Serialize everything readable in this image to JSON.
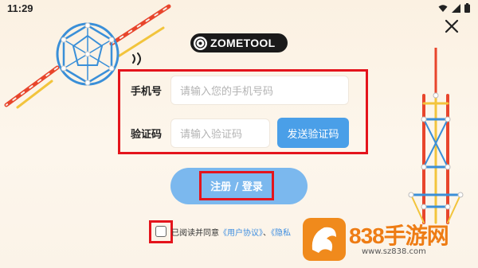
{
  "status_bar": {
    "time": "11:29"
  },
  "logo": {
    "text": "ZOMETOOL"
  },
  "form": {
    "phone_label": "手机号",
    "phone_placeholder": "请输入您的手机号码",
    "code_label": "验证码",
    "code_placeholder": "请输入验证码",
    "send_code_label": "发送验证码"
  },
  "login_button": {
    "label": "注册 / 登录"
  },
  "agreement": {
    "prefix": "已阅读并同意",
    "user_agreement": "《用户协议》",
    "separator": "、",
    "privacy": "《隐私"
  },
  "watermark": {
    "name": "838手游网",
    "url": "www.sz838.com"
  },
  "colors": {
    "accent_blue": "#4a9fe8",
    "highlight_red": "#e4141c",
    "brand_orange": "#ee7c14"
  }
}
